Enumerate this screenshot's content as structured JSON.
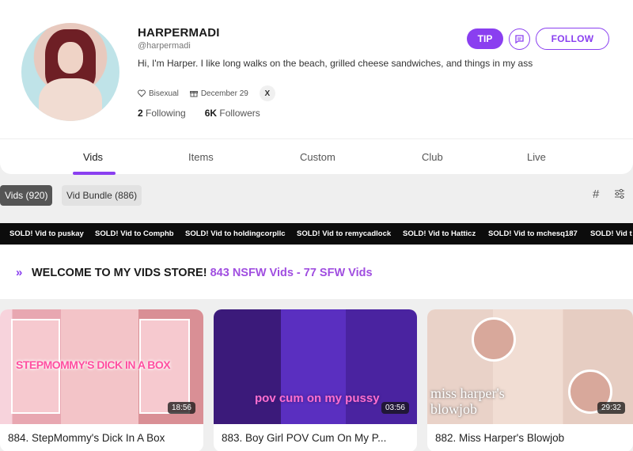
{
  "profile": {
    "name": "HARPERMADI",
    "handle": "@harpermadi",
    "bio": "Hi, I'm Harper. I like long walks on the beach, grilled cheese sandwiches, and things in my ass",
    "orientation": "Bisexual",
    "birthday": "December 29",
    "social": "X",
    "following_count": "2",
    "following_label": "Following",
    "followers_count": "6K",
    "followers_label": "Followers"
  },
  "actions": {
    "tip_label": "TIP",
    "follow_label": "FOLLOW"
  },
  "tabs": [
    {
      "label": "Vids",
      "active": true
    },
    {
      "label": "Items",
      "active": false
    },
    {
      "label": "Custom",
      "active": false
    },
    {
      "label": "Club",
      "active": false
    },
    {
      "label": "Live",
      "active": false
    }
  ],
  "filters": {
    "vids": "Vids (920)",
    "bundle": "Vid Bundle (886)"
  },
  "ticker": [
    "SOLD! Vid to puskay",
    "SOLD! Vid to Comphb",
    "SOLD! Vid to holdingcorpllc",
    "SOLD! Vid to remycadlock",
    "SOLD! Vid to Hatticz",
    "SOLD! Vid to mchesq187",
    "SOLD! Vid t"
  ],
  "welcome": {
    "main": "WELCOME TO MY VIDS STORE!",
    "highlight": "843 NSFW Vids - 77 SFW Vids"
  },
  "videos": [
    {
      "title": "884. StepMommy's Dick In A Box",
      "duration": "18:56",
      "overlay": "STEPMOMMY'S DICK IN A BOX"
    },
    {
      "title": "883. Boy Girl POV Cum On My P...",
      "duration": "03:56",
      "overlay": "pov cum on my pussy"
    },
    {
      "title": "882. Miss Harper's Blowjob",
      "duration": "29:32",
      "overlay_line1": "miss harper's",
      "overlay_line2": "blowjob"
    }
  ],
  "colors": {
    "accent": "#8a3ff0",
    "ticker_bg": "#0c0c0c",
    "highlight": "#a04ee0"
  }
}
